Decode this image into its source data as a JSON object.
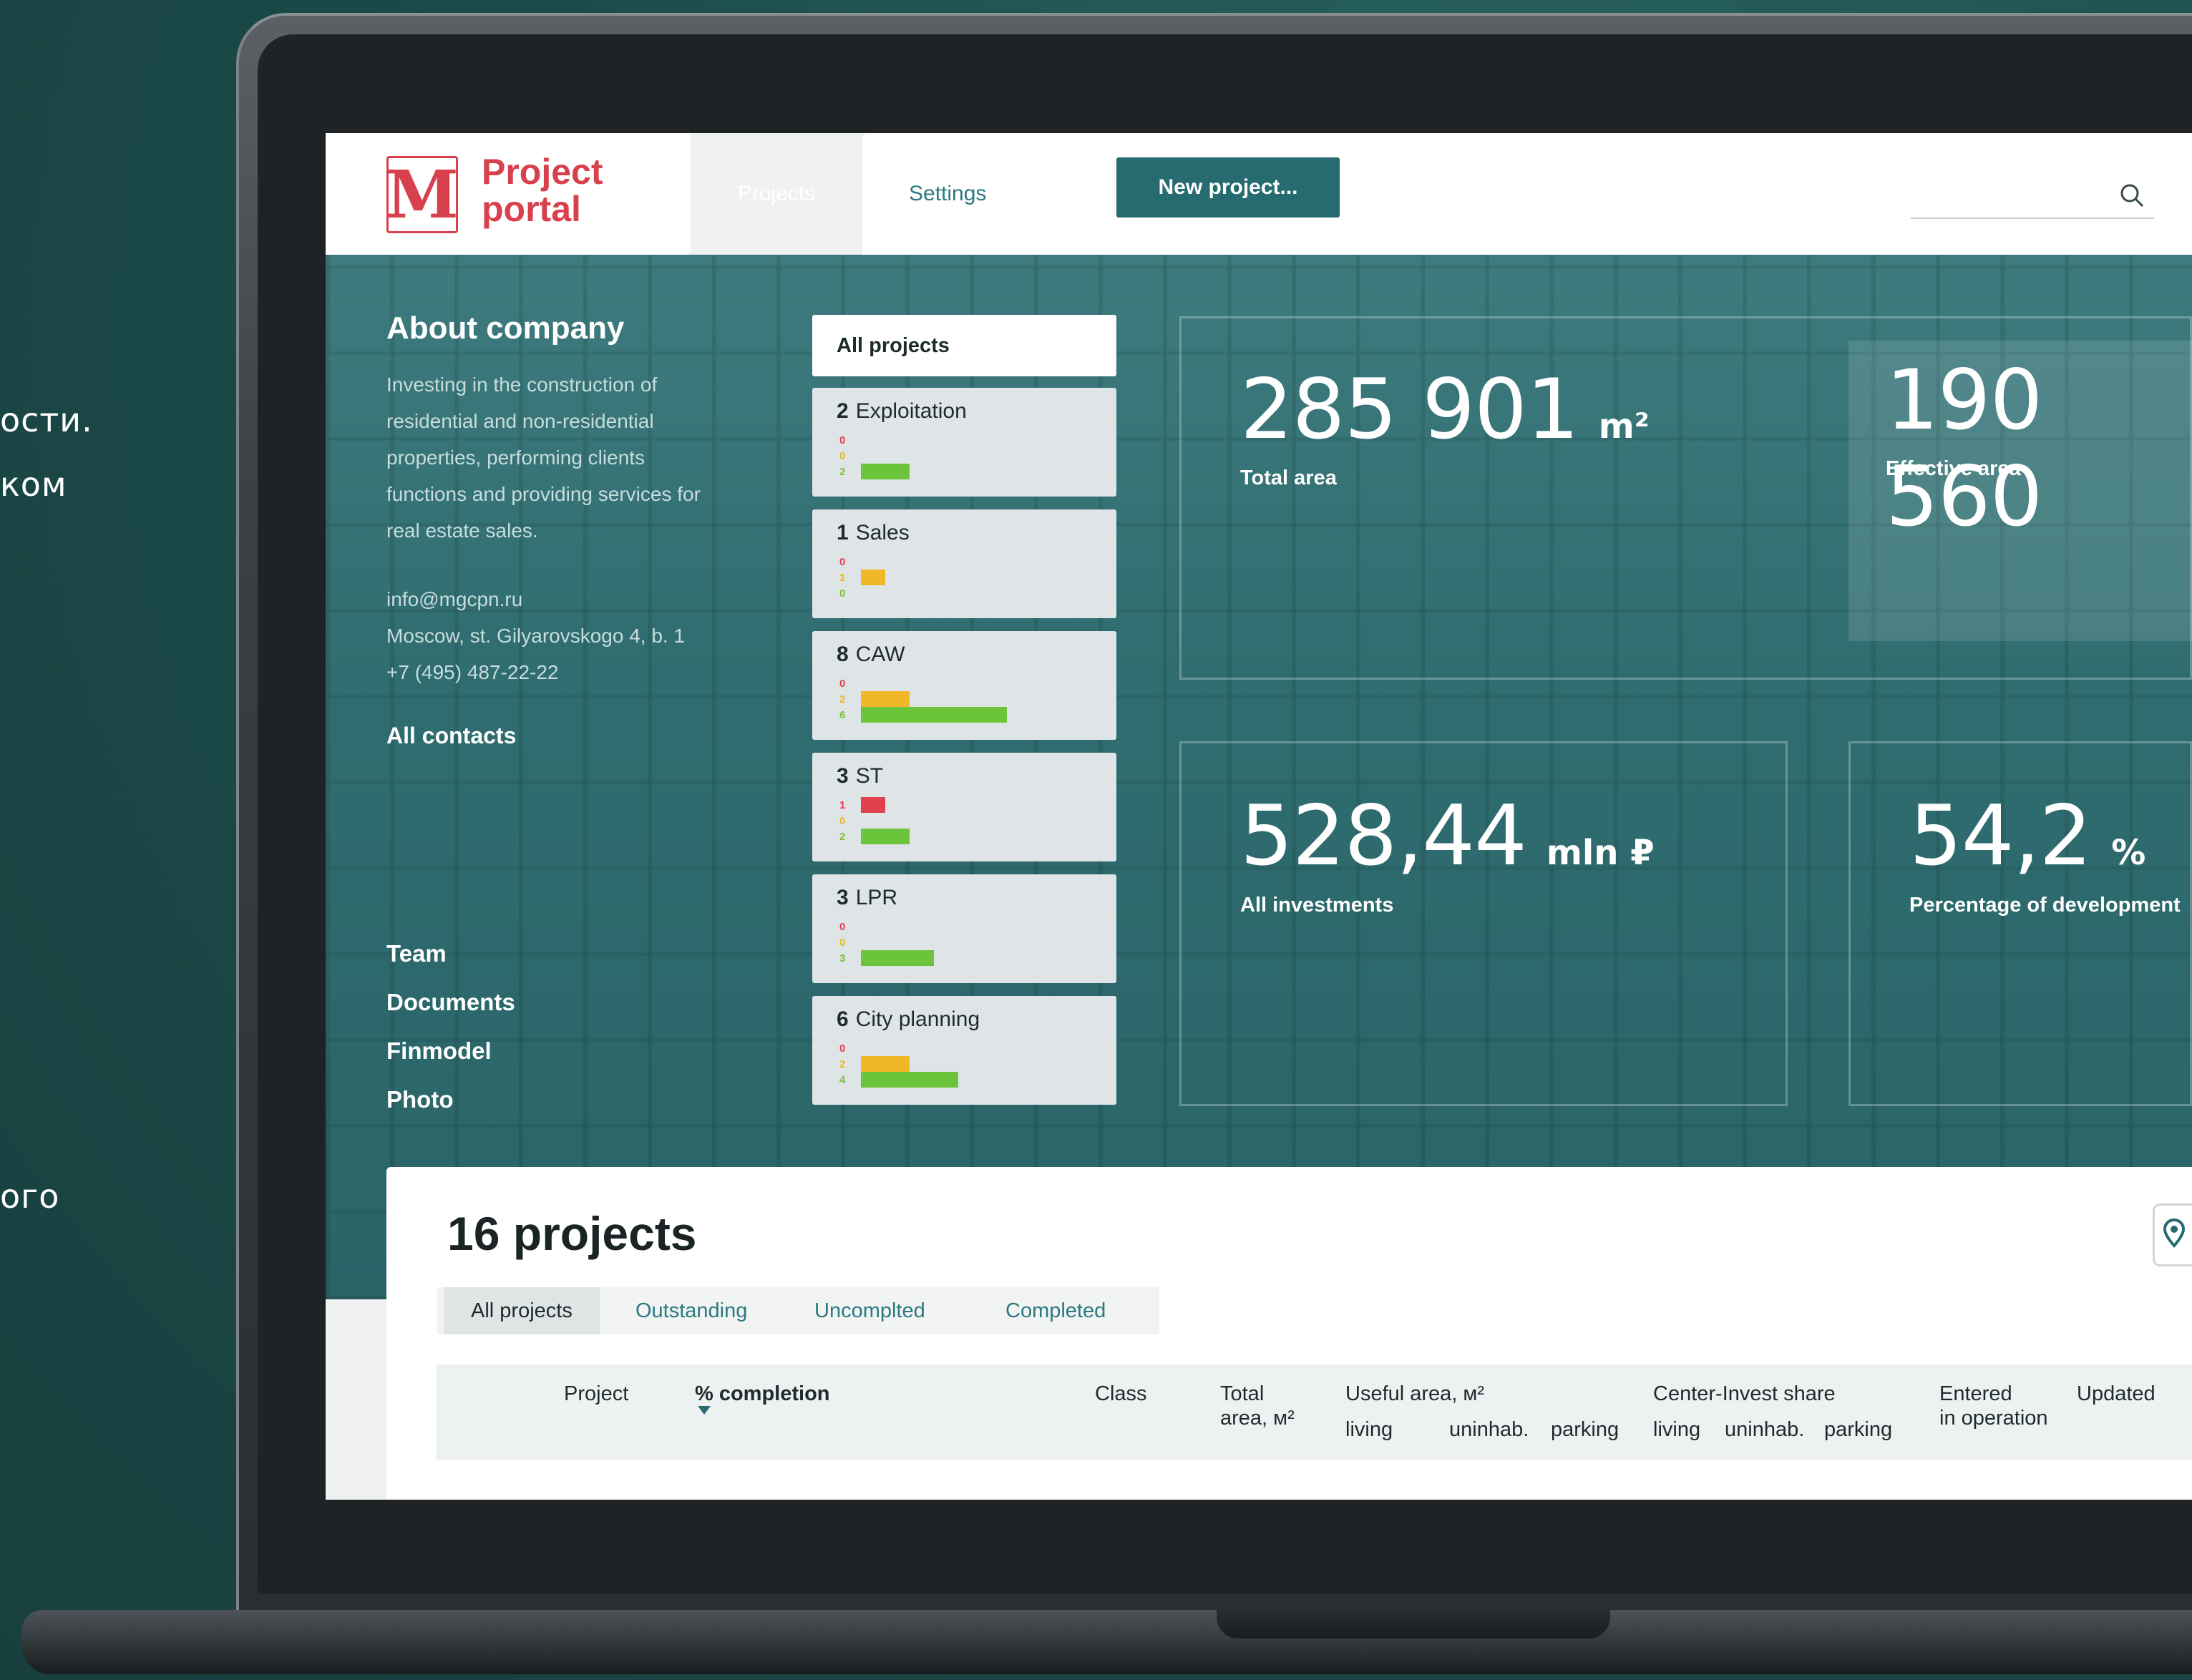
{
  "side_text": [
    "ости.",
    "ком",
    "ого"
  ],
  "header": {
    "logo_mark": "M",
    "logo_line1": "Project",
    "logo_line2": "portal",
    "tab_projects": "Projects",
    "tab_settings": "Settings",
    "new_project": "New project...",
    "search_placeholder": ""
  },
  "about": {
    "title": "About company",
    "description": "Investing in the construction of residential and non-residential properties, performing clients functions and providing services for real estate sales.",
    "email": "info@mgcpn.ru",
    "address": "Moscow, st. Gilyarovskogo 4, b. 1",
    "phone": "+7 (495) 487-22-22",
    "all_contacts": "All contacts",
    "links": [
      "Team",
      "Documents",
      "Finmodel",
      "Photo"
    ]
  },
  "project_groups": {
    "all_label": "All projects",
    "items": [
      {
        "count": "2",
        "name": "Exploitation",
        "red": 0,
        "yellow": 0,
        "green": 2
      },
      {
        "count": "1",
        "name": "Sales",
        "red": 0,
        "yellow": 1,
        "green": 0
      },
      {
        "count": "8",
        "name": "CAW",
        "red": 0,
        "yellow": 2,
        "green": 6
      },
      {
        "count": "3",
        "name": "ST",
        "red": 1,
        "yellow": 0,
        "green": 2
      },
      {
        "count": "3",
        "name": "LPR",
        "red": 0,
        "yellow": 0,
        "green": 3
      },
      {
        "count": "6",
        "name": "City planning",
        "red": 0,
        "yellow": 2,
        "green": 4
      }
    ]
  },
  "stats": {
    "total_area": {
      "value": "285 901",
      "unit": "m²",
      "label": "Total area"
    },
    "effective_area": {
      "value": "190 560",
      "label": "Effective area"
    },
    "investments": {
      "value": "528,44",
      "unit": "mln ₽",
      "label": "All investments"
    },
    "development": {
      "value": "54,2",
      "unit": "%",
      "label": "Percentage of development"
    }
  },
  "projects_list": {
    "title": "16 projects",
    "filters": [
      "All projects",
      "Outstanding",
      "Uncomplted",
      "Completed"
    ],
    "columns": {
      "project": "Project",
      "completion": "% completion",
      "class": "Class",
      "total_area_1": "Total",
      "total_area_2": "area, м²",
      "useful_area": "Useful area, м²",
      "useful_living": "living",
      "useful_uninhab": "uninhab.",
      "useful_parking": "parking",
      "center_share": "Center-Invest share",
      "share_living": "living",
      "share_uninhab": "uninhab.",
      "share_parking": "parking",
      "entered_1": "Entered",
      "entered_2": "in operation",
      "updated": "Updated"
    }
  },
  "colors": {
    "accent": "#256b70",
    "logo": "#d8404e",
    "bar_red": "#e0404c",
    "bar_yellow": "#f0b828",
    "bar_green": "#6cc43a"
  }
}
